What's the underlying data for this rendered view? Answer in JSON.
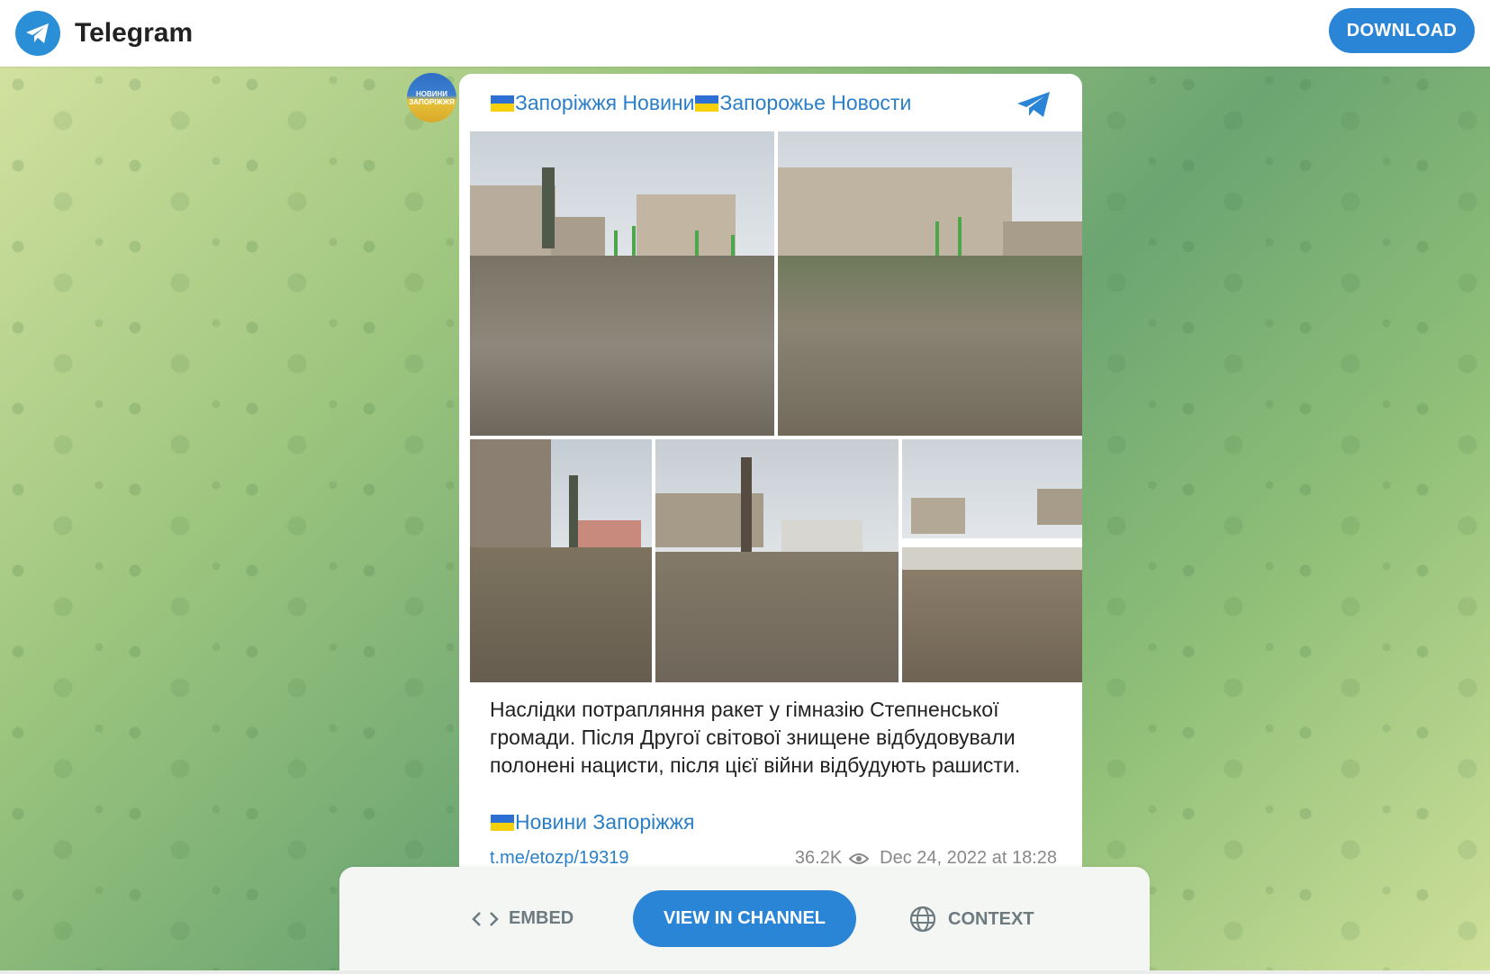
{
  "topbar": {
    "brand": "Telegram",
    "download_label": "DOWNLOAD"
  },
  "post": {
    "avatar_text_1": "НОВИНИ",
    "avatar_text_2": "ЗАПОРІЖЖЯ",
    "channel_name_part1": "Запоріжжя Новини",
    "channel_name_part2": "Запорожье Новости",
    "caption": "Наслідки потрапляння ракет у гімназію Степненської громади. Після Другої світової знищене відбудовували полонені нацисти, після цієї війни відбудують рашисти.",
    "signature": "Новини Запоріжжя",
    "link": "t.me/etozp/19319",
    "views": "36.2K",
    "datetime": "Dec 24, 2022 at 18:28"
  },
  "actions": {
    "embed_label": "EMBED",
    "view_label": "VIEW IN CHANNEL",
    "context_label": "CONTEXT"
  },
  "colors": {
    "accent": "#2b85d6",
    "link": "#2a7fc8",
    "flag_blue": "#2e6fd3",
    "flag_yellow": "#f6d10b"
  },
  "icons": [
    "telegram-logo-icon",
    "telegram-plane-icon",
    "eye-icon",
    "code-icon",
    "globe-icon"
  ]
}
